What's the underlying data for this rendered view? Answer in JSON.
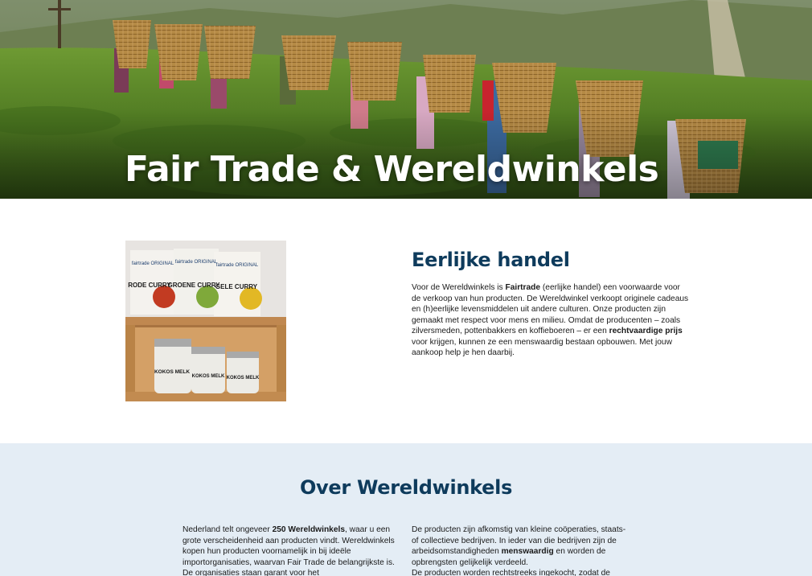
{
  "hero": {
    "title": "Fair Trade & Wereldwinkels"
  },
  "product_photo": {
    "box_labels": [
      "fairtrade ORIGINAL",
      "fairtrade ORIGINAL",
      "fairtrade ORIGINAL"
    ],
    "box_titles": [
      "RODE CURRY",
      "GROENE CURRY",
      "GELE CURRY"
    ],
    "can_titles": [
      "KOKOS MELK",
      "KOKOS MELK",
      "KOKOS MELK"
    ]
  },
  "eerlijk": {
    "heading": "Eerlijke handel",
    "p1": "Voor de Wereldwinkels is ",
    "b1": "Fairtrade",
    "p2": " (eerlijke handel) een voorwaarde voor de verkoop van hun producten. De Wereldwinkel verkoopt originele cadeaus en (h)eerlijke levensmiddelen uit andere culturen. Onze producten zijn gemaakt met respect voor mens en milieu. Omdat de producenten – zoals zilversmeden, pottenbakkers en koffieboeren – er een ",
    "b2": "rechtvaardige prijs",
    "p3": " voor krijgen, kunnen ze een menswaardig bestaan opbouwen. Met jouw aankoop help je hen daarbij."
  },
  "over": {
    "heading": "Over Wereldwinkels",
    "left_p1": "Nederland telt ongeveer ",
    "left_b1": "250 Wereldwinkels",
    "left_p2": ", waar u een grote verscheidenheid aan producten vindt. Wereldwinkels kopen hun producten voornamelijk in bij ideële importorganisaties, waarvan Fair Trade de belangrijkste is. De organisaties staan garant voor het",
    "right_p1": "De producten zijn afkomstig van kleine coöperaties, staats- of collectieve bedrijven. In ieder van die bedrijven zijn de arbeidsomstandigheden ",
    "right_b1": "menswaardig",
    "right_p2": " en worden de opbrengsten gelijkelijk verdeeld.",
    "right_p3": "De producten worden rechtstreeks ingekocht, zodat de"
  }
}
